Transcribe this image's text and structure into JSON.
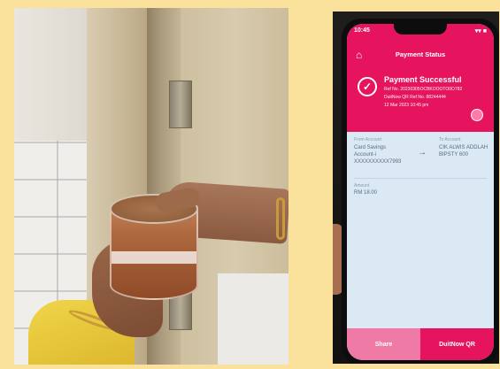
{
  "phone": {
    "status_time": "10:45",
    "status_icons": "▾▾ ■",
    "header_title": "Payment Status",
    "payment": {
      "title": "Payment Successful",
      "ref": "Ref No. 20230305OCBKOOOTO0O782",
      "duitnow_ref": "DuitNow QR Ref No. 88244444",
      "datetime": "12 Mar 2023 10:45 pm"
    },
    "from": {
      "label": "From Account",
      "account": "Card Savings Account-i XXXXXXXXXX7993"
    },
    "to": {
      "label": "To Account",
      "name": "CIK ALWIS ADDLAH BIPSTY 600"
    },
    "amount": {
      "label": "Amount",
      "value": "RM 18.00"
    },
    "footer": {
      "share_label": "Share",
      "duitnow_label": "DuitNow QR"
    }
  },
  "colors": {
    "background": "#fbe29c",
    "brand_pink": "#e6135e",
    "screen_body": "#dbe9f5"
  },
  "icons": [
    "home-icon",
    "check-circle-icon",
    "arrow-right-icon",
    "share-icon"
  ]
}
